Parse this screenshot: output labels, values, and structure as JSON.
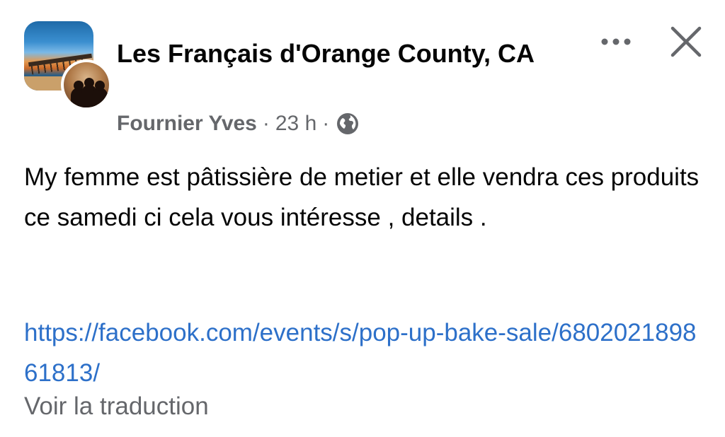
{
  "post": {
    "group_name": "Les Français d'Orange County, CA",
    "author": "Fournier Yves",
    "separator_1": "·",
    "time": "23 h",
    "separator_2": "·",
    "audience_icon": "globe-icon",
    "body": "My femme est pâtissière de metier et elle vendra ces produits ce samedi ci cela vous intéresse , details .",
    "link": "https://facebook.com/events/s/pop-up-bake-sale/680202189861813/",
    "translate_label": "Voir la traduction"
  },
  "header_actions": {
    "more_icon": "more-horizontal-icon",
    "close_icon": "close-icon"
  },
  "colors": {
    "text": "#050505",
    "secondary": "#65676b",
    "link": "#2d70c9",
    "background": "#ffffff"
  }
}
